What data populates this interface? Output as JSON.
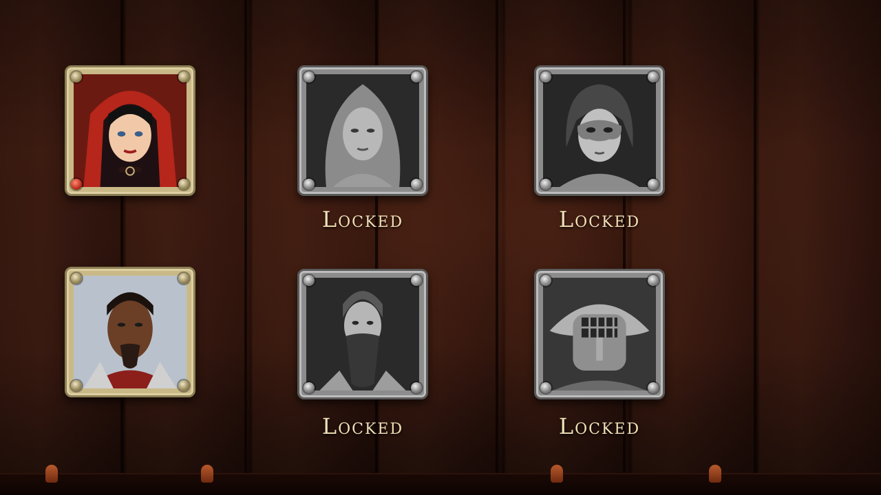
{
  "characters": [
    {
      "id": "hooded-woman",
      "state": "unlocked",
      "portrait_icon": "red-hood-woman-portrait",
      "accent": "#c42a1c",
      "label": ""
    },
    {
      "id": "long-hair-woman",
      "state": "locked",
      "portrait_icon": "long-hair-woman-portrait",
      "accent": "#7a7a7a",
      "label": "Locked"
    },
    {
      "id": "masked-woman",
      "state": "locked",
      "portrait_icon": "masked-woman-portrait",
      "accent": "#7a7a7a",
      "label": "Locked"
    },
    {
      "id": "bearded-man",
      "state": "unlocked",
      "portrait_icon": "goatee-man-portrait",
      "accent": "#b02a20",
      "label": ""
    },
    {
      "id": "braided-beard-man",
      "state": "locked",
      "portrait_icon": "braided-beard-man-portrait",
      "accent": "#7a7a7a",
      "label": "Locked"
    },
    {
      "id": "helmet-gladiator",
      "state": "locked",
      "portrait_icon": "gladiator-helmet-portrait",
      "accent": "#7a7a7a",
      "label": "Locked"
    }
  ],
  "colors": {
    "wood_dark": "#2a120b",
    "frame_gold": "#c9b987",
    "frame_silver": "#8c8c8c",
    "label_text": "#efe0b8"
  }
}
